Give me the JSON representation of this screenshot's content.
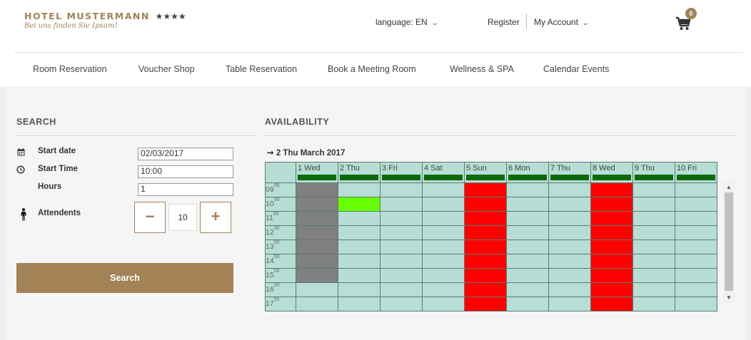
{
  "header": {
    "brand_name": "HOTEL MUSTERMANN",
    "brand_stars": "★★★★",
    "brand_tagline": "Bei uns finden Sie Ipsum!",
    "language_label": "language: EN",
    "register_label": "Register",
    "account_label": "My Account",
    "cart_count": "0"
  },
  "nav": {
    "items": [
      "Room Reservation",
      "Voucher Shop",
      "Table Reservation",
      "Book a Meeting Room",
      "Wellness & SPA",
      "Calendar Events"
    ]
  },
  "search": {
    "title": "SEARCH",
    "start_date_label": "Start date",
    "start_date_value": "02/03/2017",
    "start_time_label": "Start Time",
    "start_time_value": "10:00",
    "hours_label": "Hours",
    "hours_value": "1",
    "attendees_label": "Attendents",
    "attendees_value": "10",
    "minus_label": "−",
    "plus_label": "+",
    "button_label": "Search"
  },
  "availability": {
    "title": "AVAILABILITY",
    "date_heading": "2 Thu March 2017",
    "days": [
      "1 Wed",
      "2 Thu",
      "3 Fri",
      "4 Sat",
      "5 Sun",
      "6 Mon",
      "7 Thu",
      "8 Wed",
      "9 Thu",
      "10 Fri"
    ],
    "hours": [
      "09",
      "10",
      "11",
      "12",
      "13",
      "14",
      "15",
      "16",
      "17"
    ],
    "hour_suffix": "00",
    "status_colors": {
      "free": "#b6ded4",
      "past": "#808080",
      "closed": "#ff0000",
      "selected": "#66ff00"
    },
    "cells": [
      [
        "past",
        "free",
        "free",
        "free",
        "closed",
        "free",
        "free",
        "closed",
        "free",
        "free"
      ],
      [
        "past",
        "selected",
        "free",
        "free",
        "closed",
        "free",
        "free",
        "closed",
        "free",
        "free"
      ],
      [
        "past",
        "free",
        "free",
        "free",
        "closed",
        "free",
        "free",
        "closed",
        "free",
        "free"
      ],
      [
        "past",
        "free",
        "free",
        "free",
        "closed",
        "free",
        "free",
        "closed",
        "free",
        "free"
      ],
      [
        "past",
        "free",
        "free",
        "free",
        "closed",
        "free",
        "free",
        "closed",
        "free",
        "free"
      ],
      [
        "past",
        "free",
        "free",
        "free",
        "closed",
        "free",
        "free",
        "closed",
        "free",
        "free"
      ],
      [
        "past",
        "free",
        "free",
        "free",
        "closed",
        "free",
        "free",
        "closed",
        "free",
        "free"
      ],
      [
        "free",
        "free",
        "free",
        "free",
        "closed",
        "free",
        "free",
        "closed",
        "free",
        "free"
      ],
      [
        "free",
        "free",
        "free",
        "free",
        "closed",
        "free",
        "free",
        "closed",
        "free",
        "free"
      ]
    ]
  }
}
